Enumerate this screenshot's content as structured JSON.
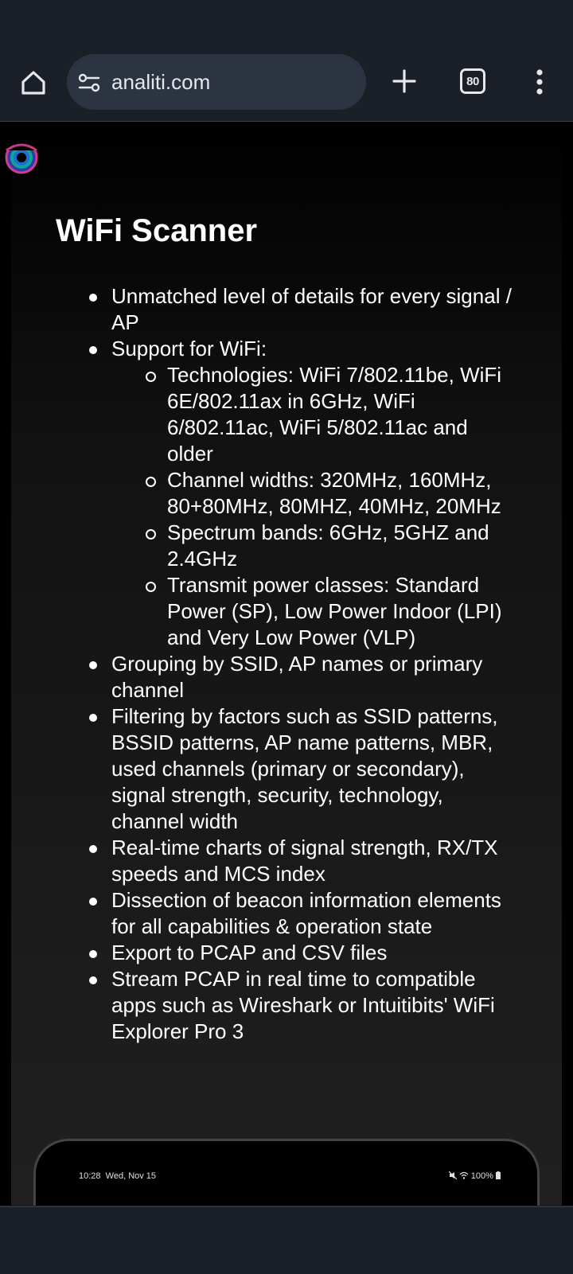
{
  "browser": {
    "url": "analiti.com",
    "tab_count": "80",
    "icons": [
      "home-icon",
      "site-settings-icon",
      "new-tab-icon",
      "tabs-icon",
      "more-menu-icon"
    ]
  },
  "page": {
    "title": "WiFi Scanner",
    "features": [
      "Unmatched level of details for every signal / AP",
      "Support for WiFi:",
      "Grouping by SSID, AP names or primary channel",
      "Filtering by factors such as SSID patterns, BSSID patterns, AP name patterns, MBR, used channels (primary or secondary), signal strength, security, technology, channel width",
      "Real-time charts of signal strength, RX/TX speeds and MCS index",
      "Dissection of beacon information elements for all capabilities & operation state",
      "Export to PCAP and CSV files",
      "Stream PCAP in real time to compatible apps such as Wireshark or Intuitibits' WiFi Explorer Pro 3"
    ],
    "wifi_support": [
      "Technologies: WiFi 7/802.11be, WiFi 6E/802.11ax in 6GHz, WiFi 6/802.11ac, WiFi 5/802.11ac and older",
      "Channel widths: 320MHz, 160MHz, 80+80MHz, 80MHZ, 40MHz, 20MHz",
      "Spectrum bands: 6GHz, 5GHZ and 2.4GHz",
      "Transmit power classes: Standard Power (SP), Low Power Indoor (LPI) and Very Low Power (VLP)"
    ]
  },
  "phone_preview": {
    "time": "10:28",
    "date": "Wed, Nov 15",
    "battery": "100%"
  },
  "colors": {
    "browser_chrome": "#1a1f28",
    "url_bar": "#2d3441",
    "page_background": "#000000"
  }
}
